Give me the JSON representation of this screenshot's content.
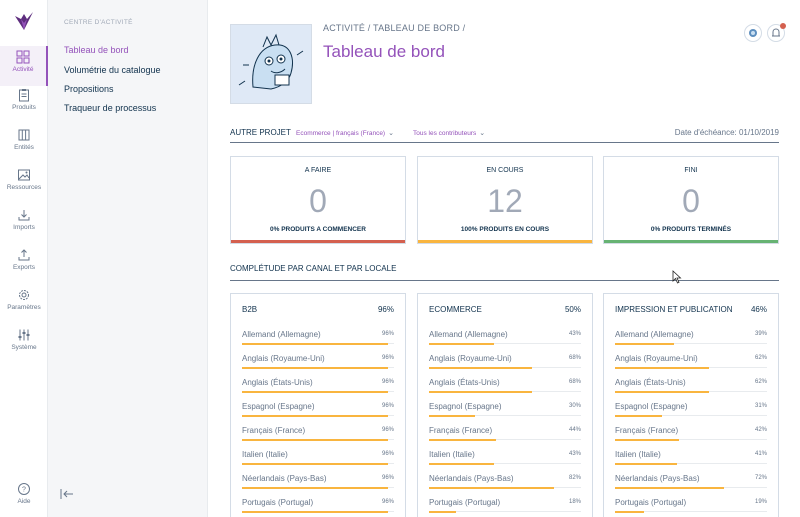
{
  "nav": {
    "items": [
      {
        "label": "Activité",
        "icon": "grid-icon"
      },
      {
        "label": "Produits",
        "icon": "clipboard-icon"
      },
      {
        "label": "Entités",
        "icon": "columns-icon"
      },
      {
        "label": "Ressources",
        "icon": "image-icon"
      },
      {
        "label": "Imports",
        "icon": "import-icon"
      },
      {
        "label": "Exports",
        "icon": "export-icon"
      },
      {
        "label": "Paramètres",
        "icon": "gear-icon"
      },
      {
        "label": "Système",
        "icon": "sliders-icon"
      }
    ],
    "help": "Aide"
  },
  "subnav": {
    "title": "CENTRE D'ACTIVITÉ",
    "links": [
      "Tableau de bord",
      "Volumétrie du catalogue",
      "Propositions",
      "Traqueur de processus"
    ]
  },
  "header": {
    "breadcrumb": "ACTIVITÉ / TABLEAU DE BORD /",
    "title": "Tableau de bord"
  },
  "filters": {
    "label": "AUTRE PROJET",
    "scope": "Ecommerce | français (France)",
    "contributors": "Tous les contributeurs",
    "due_date": "Date d'échéance: 01/10/2019"
  },
  "status_cards": [
    {
      "title": "A FAIRE",
      "count": "0",
      "caption": "0% PRODUITS A COMMENCER",
      "color": "#d4604f"
    },
    {
      "title": "EN COURS",
      "count": "12",
      "caption": "100% PRODUITS EN COURS",
      "color": "#f9b53f"
    },
    {
      "title": "FINI",
      "count": "0",
      "caption": "0% PRODUITS TERMINÉS",
      "color": "#67b373"
    }
  ],
  "completeness": {
    "title": "COMPLÉTUDE PAR CANAL ET PAR LOCALE",
    "channels": [
      {
        "name": "B2B",
        "percent": "96%",
        "locales": [
          {
            "name": "Allemand (Allemagne)",
            "value": "96%",
            "ratio": 0.96
          },
          {
            "name": "Anglais (Royaume-Uni)",
            "value": "96%",
            "ratio": 0.96
          },
          {
            "name": "Anglais (États-Unis)",
            "value": "96%",
            "ratio": 0.96
          },
          {
            "name": "Espagnol (Espagne)",
            "value": "96%",
            "ratio": 0.96
          },
          {
            "name": "Français (France)",
            "value": "96%",
            "ratio": 0.96
          },
          {
            "name": "Italien (Italie)",
            "value": "96%",
            "ratio": 0.96
          },
          {
            "name": "Néerlandais (Pays-Bas)",
            "value": "96%",
            "ratio": 0.96
          },
          {
            "name": "Portugais (Portugal)",
            "value": "96%",
            "ratio": 0.96
          }
        ]
      },
      {
        "name": "ECOMMERCE",
        "percent": "50%",
        "locales": [
          {
            "name": "Allemand (Allemagne)",
            "value": "43%",
            "ratio": 0.43
          },
          {
            "name": "Anglais (Royaume-Uni)",
            "value": "68%",
            "ratio": 0.68
          },
          {
            "name": "Anglais (États-Unis)",
            "value": "68%",
            "ratio": 0.68
          },
          {
            "name": "Espagnol (Espagne)",
            "value": "30%",
            "ratio": 0.3
          },
          {
            "name": "Français (France)",
            "value": "44%",
            "ratio": 0.44
          },
          {
            "name": "Italien (Italie)",
            "value": "43%",
            "ratio": 0.43
          },
          {
            "name": "Néerlandais (Pays-Bas)",
            "value": "82%",
            "ratio": 0.82
          },
          {
            "name": "Portugais (Portugal)",
            "value": "18%",
            "ratio": 0.18
          }
        ]
      },
      {
        "name": "IMPRESSION ET PUBLICATION",
        "percent": "46%",
        "locales": [
          {
            "name": "Allemand (Allemagne)",
            "value": "39%",
            "ratio": 0.39
          },
          {
            "name": "Anglais (Royaume-Uni)",
            "value": "62%",
            "ratio": 0.62
          },
          {
            "name": "Anglais (États-Unis)",
            "value": "62%",
            "ratio": 0.62
          },
          {
            "name": "Espagnol (Espagne)",
            "value": "31%",
            "ratio": 0.31
          },
          {
            "name": "Français (France)",
            "value": "42%",
            "ratio": 0.42
          },
          {
            "name": "Italien (Italie)",
            "value": "41%",
            "ratio": 0.41
          },
          {
            "name": "Néerlandais (Pays-Bas)",
            "value": "72%",
            "ratio": 0.72
          },
          {
            "name": "Portugais (Portugal)",
            "value": "19%",
            "ratio": 0.19
          }
        ]
      }
    ]
  },
  "colors": {
    "accent": "#9452ba",
    "progress": "#f9b53f"
  }
}
